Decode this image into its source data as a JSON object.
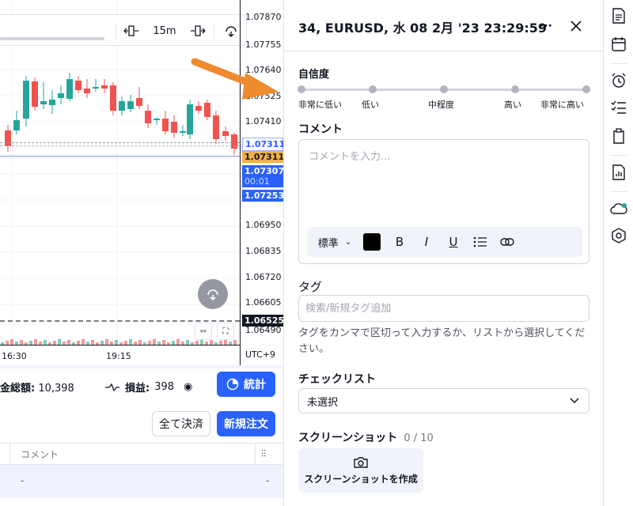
{
  "chart": {
    "timeframe": "15m",
    "price_ticks": [
      "1.07870",
      "1.07755",
      "1.07640",
      "1.07525",
      "1.07410",
      "1.06950",
      "1.06835",
      "1.06720",
      "1.06605",
      "1.06490"
    ],
    "price_labels": {
      "level_1": "1.07311",
      "level_2": "1.07311",
      "current_price": "1.07307",
      "countdown": "00:01",
      "level_3": "1.07253",
      "level_4": "1.06525"
    },
    "time_ticks": [
      "16:30",
      "19:15"
    ],
    "timezone": "UTC+9",
    "colors": {
      "up": "#26a69a",
      "down": "#ef5350",
      "accent": "#2962ff",
      "orange": "#f0983b"
    }
  },
  "bottom": {
    "equity_label": "金総額:",
    "equity_value": "10,398",
    "pnl_label": "損益:",
    "pnl_value": "398",
    "stats_button": "統計",
    "close_all_button": "全て決済",
    "new_order_button": "新規注文",
    "table_header_comment": "コメント",
    "row_dash_1": "-",
    "row_dash_2": "-"
  },
  "panel": {
    "title": "34, EURUSD, 水 08 2月 '23 23:29:59",
    "more_label": "···",
    "confidence": {
      "label": "自信度",
      "levels": [
        "非常に低い",
        "低い",
        "中程度",
        "高い",
        "非常に高い"
      ]
    },
    "comment": {
      "label": "コメント",
      "placeholder": "コメントを入力...",
      "value": "",
      "format_style": "標準",
      "bold": "B",
      "italic": "I",
      "underline": "U"
    },
    "tags": {
      "label": "タグ",
      "placeholder": "検索/新規タグ追加",
      "help": "タグをカンマで区切って入力するか、リストから選択してください。"
    },
    "checklist": {
      "label": "チェックリスト",
      "selected": "未選択"
    },
    "screenshot": {
      "label": "スクリーンショット",
      "count": "0 / 10",
      "button": "スクリーンショットを作成"
    }
  }
}
